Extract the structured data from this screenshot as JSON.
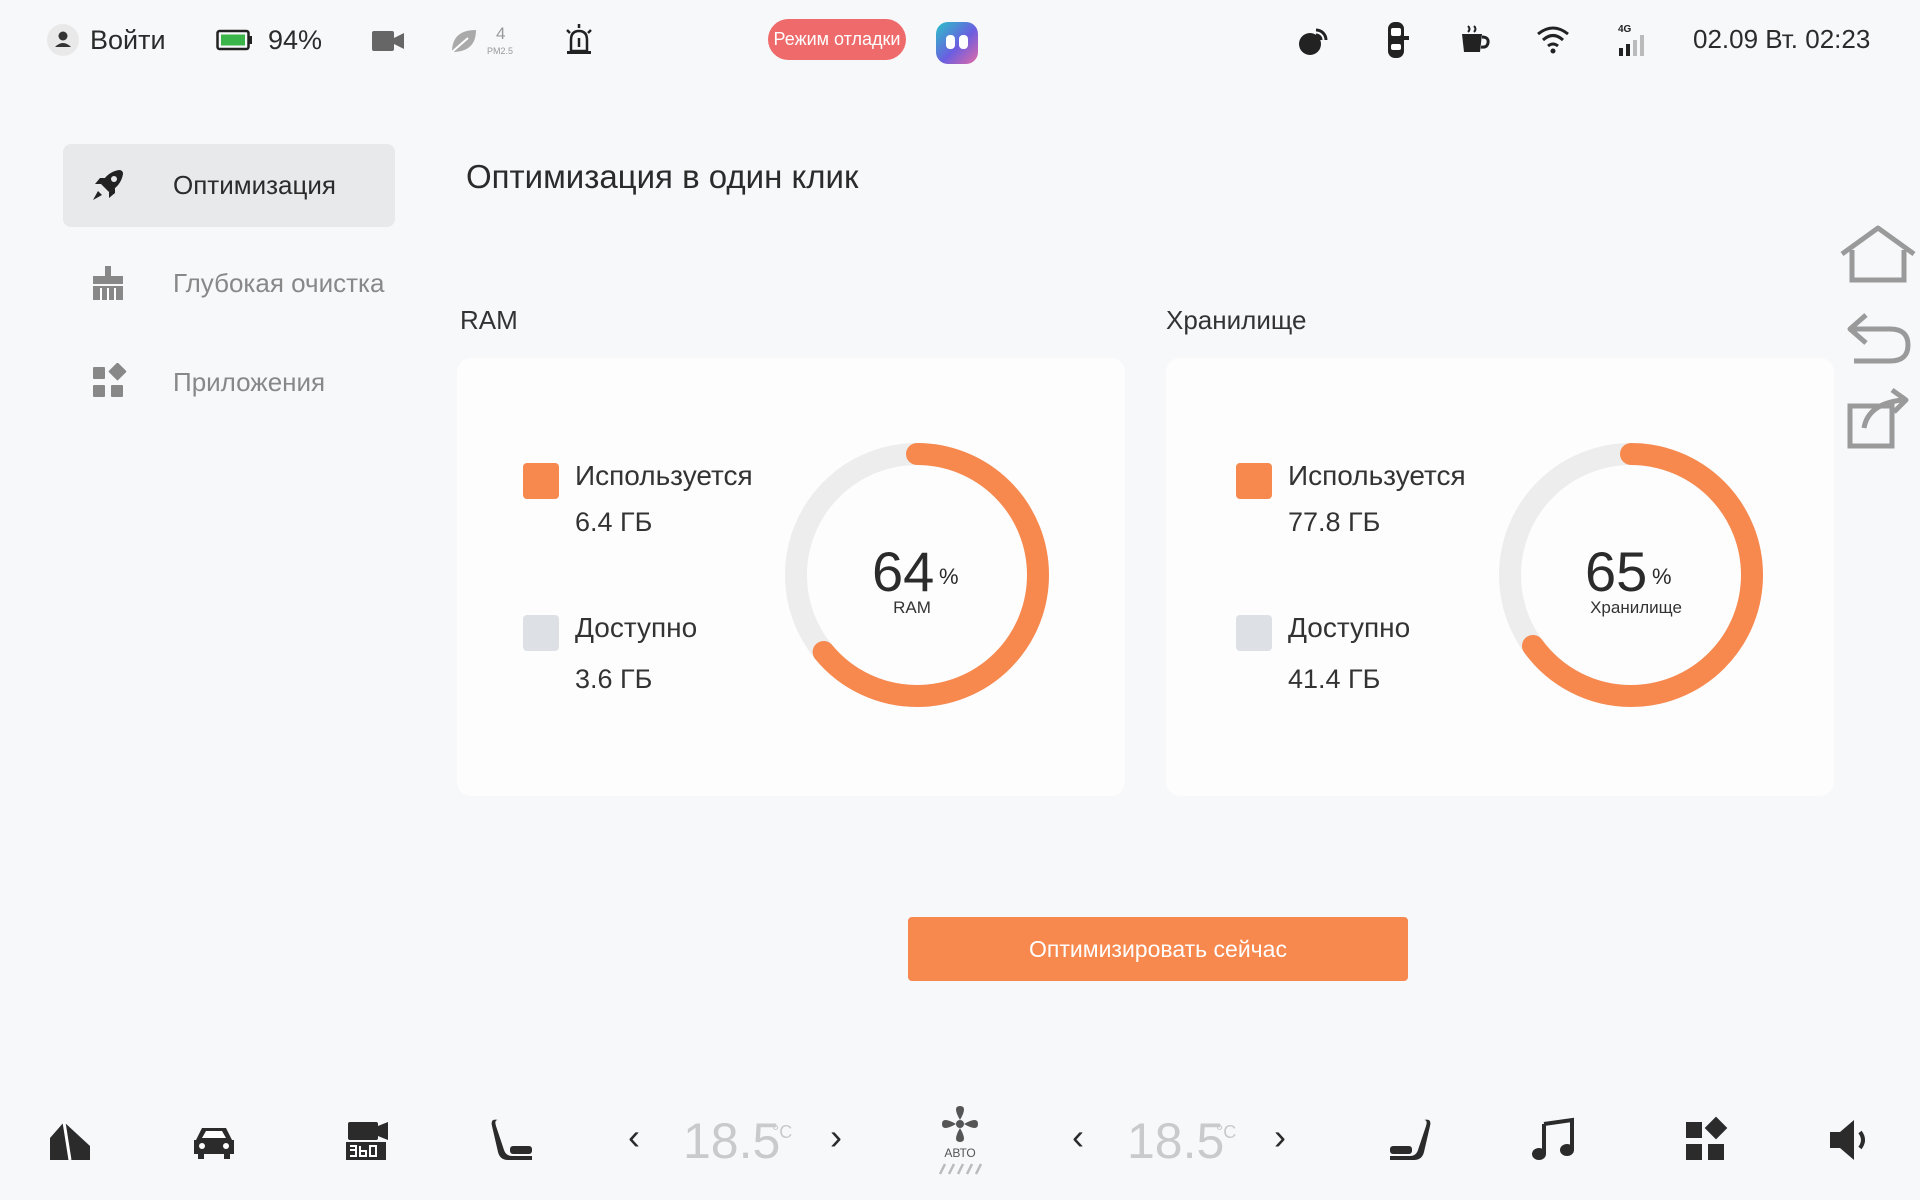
{
  "status_bar": {
    "login_label": "Войти",
    "battery_percent": "94%",
    "pm25_value": "4",
    "pm25_label": "PM2.5",
    "debug_mode_label": "Режим отладки",
    "datetime": "02.09 Вт. 02:23",
    "network_label": "4G"
  },
  "sidebar": {
    "items": [
      {
        "label": "Оптимизация",
        "icon": "rocket-icon",
        "active": true
      },
      {
        "label": "Глубокая очистка",
        "icon": "broom-icon",
        "active": false
      },
      {
        "label": "Приложения",
        "icon": "apps-icon",
        "active": false
      }
    ]
  },
  "main": {
    "title": "Оптимизация в один клик",
    "ram": {
      "section_title": "RAM",
      "used_label": "Используется",
      "used_value": "6.4 ГБ",
      "free_label": "Доступно",
      "free_value": "3.6 ГБ",
      "percent": "64",
      "percent_sign": "%",
      "caption": "RAM",
      "used_fraction": 0.64
    },
    "storage": {
      "section_title": "Хранилище",
      "used_label": "Используется",
      "used_value": "77.8 ГБ",
      "free_label": "Доступно",
      "free_value": "41.4 ГБ",
      "percent": "65",
      "percent_sign": "%",
      "caption": "Хранилище",
      "used_fraction": 0.65
    },
    "action_button": "Оптимизировать сейчас"
  },
  "dock": {
    "left_temp": "18.5",
    "right_temp": "18.5",
    "temp_unit": "°C",
    "fan_mode": "АВТО"
  },
  "colors": {
    "accent": "#f7894f",
    "free": "#dde1e6",
    "track": "#ededed",
    "debug": "#ef6a6a"
  }
}
